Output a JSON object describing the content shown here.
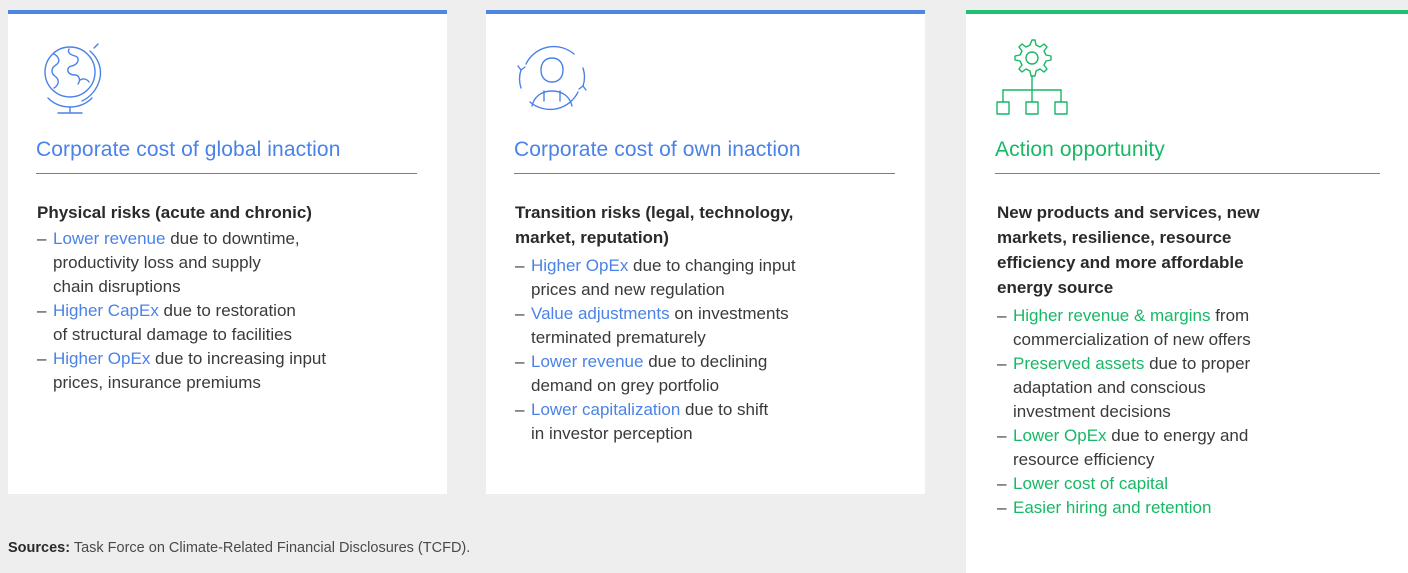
{
  "cards": [
    {
      "icon": "globe-icon",
      "title": "Corporate cost of global inaction",
      "subhead": "Physical risks (acute and chronic)",
      "items": [
        {
          "hl": "Lower revenue",
          "rest_1": " due to downtime,",
          "rest_2": "productivity loss and supply",
          "rest_3": "chain disruptions"
        },
        {
          "hl": "Higher CapEx",
          "rest_1": " due to restoration",
          "rest_2": "of structural damage to facilities"
        },
        {
          "hl": "Higher OpEx",
          "rest_1": " due to increasing input",
          "rest_2": "prices, insurance premiums"
        }
      ]
    },
    {
      "icon": "person-cycle-icon",
      "title": "Corporate cost of own inaction",
      "subhead_1": "Transition risks (legal, technology,",
      "subhead_2": "market, reputation)",
      "items": [
        {
          "hl": "Higher OpEx",
          "rest_1": " due to changing input",
          "rest_2": "prices and new regulation"
        },
        {
          "hl": "Value adjustments",
          "rest_1": " on investments",
          "rest_2": "terminated prematurely"
        },
        {
          "hl": "Lower revenue",
          "rest_1": " due to declining",
          "rest_2": "demand on grey portfolio"
        },
        {
          "hl": "Lower capitalization",
          "rest_1": " due to shift",
          "rest_2": "in investor perception"
        }
      ]
    },
    {
      "icon": "gear-hierarchy-icon",
      "title": "Action opportunity",
      "subhead_1": "New products and services, new",
      "subhead_2": "markets, resilience, resource",
      "subhead_3": "efficiency and more affordable",
      "subhead_4": "energy source",
      "items": [
        {
          "hl": "Higher revenue & margins",
          "rest_1": " from",
          "rest_2": "commercialization of new offers"
        },
        {
          "hl": "Preserved assets",
          "rest_1": " due to proper",
          "rest_2": "adaptation and conscious",
          "rest_3": "investment decisions"
        },
        {
          "hl": "Lower OpEx",
          "rest_1": " due to energy and",
          "rest_2": "resource efficiency"
        },
        {
          "hl": "Lower cost of capital"
        },
        {
          "hl": "Easier hiring and retention"
        }
      ]
    }
  ],
  "sources": {
    "label": "Sources:",
    "text": " Task Force on Climate-Related Financial Disclosures (TCFD)."
  },
  "colors": {
    "blue": "#4a82e8",
    "green": "#17b866",
    "background": "#eeeeee"
  }
}
